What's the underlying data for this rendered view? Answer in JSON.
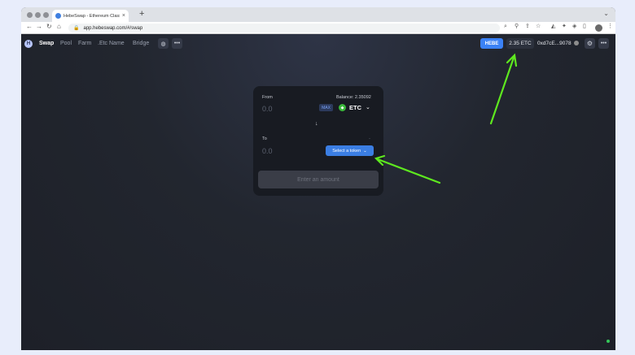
{
  "browser": {
    "tab_title": "HebeSwap - Ethereum Classic",
    "tab_close": "×",
    "new_tab": "+",
    "tab_menu": "⌄",
    "url": "app.hebeswap.com/#/swap",
    "nav_back": "←",
    "nav_forward": "→",
    "nav_reload": "↻",
    "nav_home": "⌂",
    "lock": "🔒"
  },
  "nav": {
    "logo": "H",
    "items": [
      "Swap",
      "Pool",
      "Farm",
      ".Etc Name",
      "Bridge"
    ],
    "globe": "◍",
    "more": "•••"
  },
  "wallet": {
    "hebe_label": "HEBE",
    "balance_label": "2.35 ETC",
    "address": "0xd7cE...9078",
    "settings": "⚙",
    "more": "•••"
  },
  "swap": {
    "from_label": "From",
    "balance_text": "Balance: 2.35092",
    "from_amount": "0.0",
    "max_label": "MAX",
    "token_icon": "◆",
    "token_symbol": "ETC",
    "token_chevron": "⌄",
    "switch_arrow": "↓",
    "to_label": "To",
    "to_balance": "-",
    "to_amount": "0.0",
    "select_token_label": "Select a token",
    "select_chevron": "⌄",
    "enter_amount_label": "Enter an amount"
  },
  "colors": {
    "accent": "#3b7ee3",
    "annotation_arrow": "#5ee81f"
  }
}
